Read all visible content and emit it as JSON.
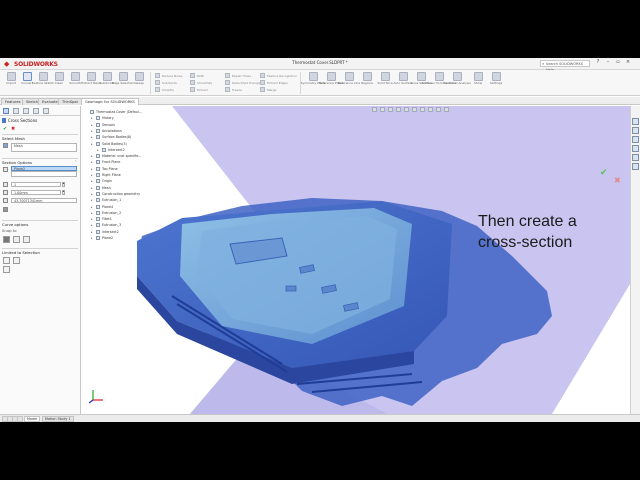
{
  "app": {
    "logo_text": "SOLIDWORKS",
    "document_title": "Thermostat Cover.SLDPRT *",
    "search_placeholder": "Search SOLIDWORKS Help"
  },
  "command_manager": {
    "buttons": [
      {
        "label": "Import",
        "icon": "import-icon"
      },
      {
        "label": "Convert",
        "icon": "convert-icon"
      },
      {
        "label": "Feature Sketch",
        "icon": "feature-sketch-icon"
      },
      {
        "label": "Clean",
        "icon": "clean-icon"
      },
      {
        "label": "Smooth",
        "icon": "smooth-icon"
      },
      {
        "label": "Extract Mesh",
        "icon": "extract-mesh-icon"
      },
      {
        "label": "Subdivide",
        "icon": "subdivide-icon"
      },
      {
        "label": "Edge Selection",
        "icon": "edge-selection-icon"
      },
      {
        "label": "Sweep",
        "icon": "sweep-icon"
      }
    ],
    "small_groups": [
      [
        "Reduce Noise",
        "Subdivide",
        "Simplify"
      ],
      [
        "Refit",
        "Smoothify",
        "Extract"
      ],
      [
        "Repair Holes",
        "Detect/Set Triangles",
        "Freeze"
      ],
      [
        "Feature Recognition",
        "Extract Edges",
        "Merge"
      ]
    ],
    "right_buttons": [
      {
        "label": "Symmetry Plane",
        "icon": "symmetry-plane-icon"
      },
      {
        "label": "Reference Plane",
        "icon": "reference-plane-icon"
      },
      {
        "label": "Reference Line",
        "icon": "reference-line-icon"
      },
      {
        "label": "Regions",
        "icon": "regions-icon"
      },
      {
        "label": "Solid Slice",
        "icon": "solid-slice-icon"
      },
      {
        "label": "Auto Surface",
        "icon": "auto-surface-icon"
      },
      {
        "label": "Cross Sections",
        "icon": "cross-sections-icon"
      },
      {
        "label": "Surfaces from Sections",
        "icon": "surfaces-from-sections-icon"
      },
      {
        "label": "Deviation Analysis",
        "icon": "deviation-analysis-icon"
      },
      {
        "label": "Show",
        "icon": "show-icon"
      },
      {
        "label": "Settings",
        "icon": "settings-icon"
      }
    ]
  },
  "command_tabs": [
    "Features",
    "Sketch",
    "Evaluate",
    "ThinSpot",
    "Geomagic for SOLIDWORKS"
  ],
  "property_manager": {
    "title": "Cross Sections",
    "select_mesh_label": "Select Mesh",
    "mesh_value": "Mesh",
    "section_options_label": "Section Options",
    "plane_value": "Plane2",
    "count_value": "1",
    "spacing_value": "1.00mm",
    "offset_value": "43.70071341mm",
    "curve_options_label": "Curve options",
    "snap_label": "Snap to",
    "limited_label": "Limited to Selection"
  },
  "feature_tree": [
    {
      "label": "Thermostat Cover  (Defaul...",
      "level": 0
    },
    {
      "label": "History",
      "level": 1
    },
    {
      "label": "Sensors",
      "level": 1
    },
    {
      "label": "Annotations",
      "level": 1
    },
    {
      "label": "Surface Bodies(8)",
      "level": 1
    },
    {
      "label": "Solid Bodies(3)",
      "level": 1
    },
    {
      "label": "Intersect2",
      "level": 2
    },
    {
      "label": "Material <not specifie...",
      "level": 1
    },
    {
      "label": "Front Plane",
      "level": 1
    },
    {
      "label": "Top Plane",
      "level": 1
    },
    {
      "label": "Right Plane",
      "level": 1
    },
    {
      "label": "Origin",
      "level": 1
    },
    {
      "label": "Mesh",
      "level": 1
    },
    {
      "label": "Construction geometry",
      "level": 1
    },
    {
      "label": "Extrusion_1",
      "level": 1
    },
    {
      "label": "Plane4",
      "level": 1
    },
    {
      "label": "Extrusion_2",
      "level": 1
    },
    {
      "label": "Fillet1",
      "level": 1
    },
    {
      "label": "Extrusion_3",
      "level": 1
    },
    {
      "label": "Intersect2",
      "level": 1
    },
    {
      "label": "Plane2",
      "level": 1
    }
  ],
  "overlay": {
    "line1": "Then create a",
    "line2": "cross-section"
  },
  "bottom_tabs": [
    "Model",
    "Motion Study 1"
  ],
  "colors": {
    "background_plane": "#c6c3ef",
    "mesh_blue": "#3f63c4",
    "mesh_dark": "#2c4aa6",
    "mesh_top": "#6fa3d8",
    "selection": "#bcd8f4"
  }
}
